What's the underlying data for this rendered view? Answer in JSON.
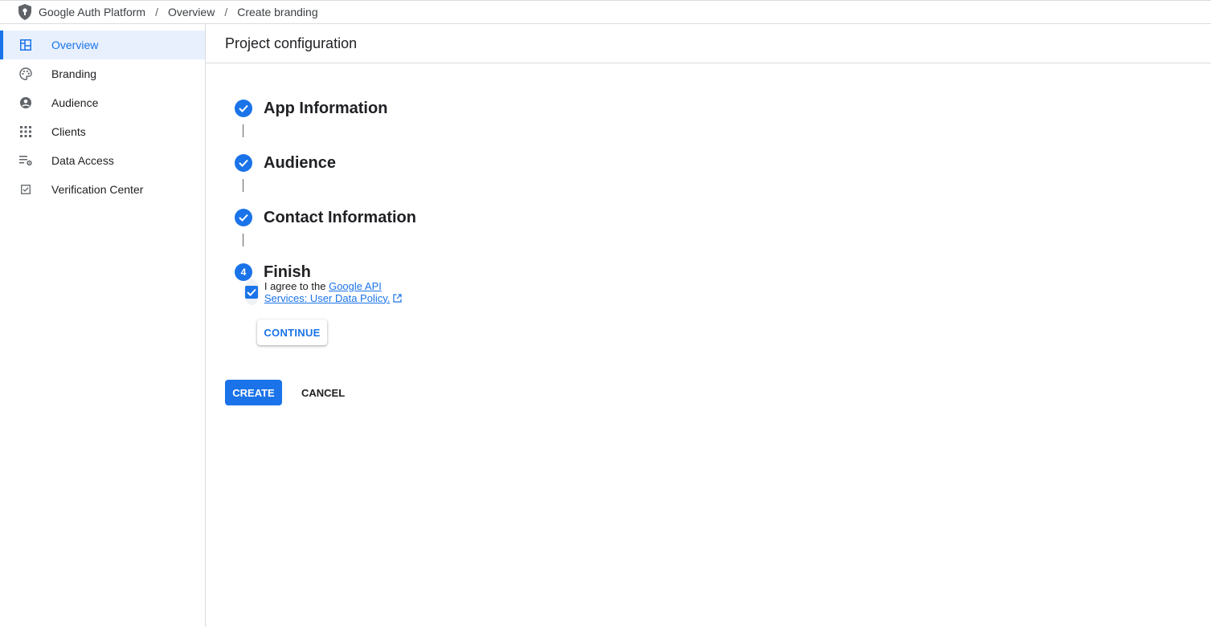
{
  "breadcrumb": {
    "items": [
      "Google Auth Platform",
      "Overview",
      "Create branding"
    ],
    "separator": "/"
  },
  "sidebar": {
    "items": [
      {
        "label": "Overview",
        "icon": "dashboard-icon",
        "active": true
      },
      {
        "label": "Branding",
        "icon": "palette-icon",
        "active": false
      },
      {
        "label": "Audience",
        "icon": "account-circle-icon",
        "active": false
      },
      {
        "label": "Clients",
        "icon": "apps-grid-icon",
        "active": false
      },
      {
        "label": "Data Access",
        "icon": "list-settings-icon",
        "active": false
      },
      {
        "label": "Verification Center",
        "icon": "checkbox-icon",
        "active": false
      }
    ]
  },
  "main": {
    "title": "Project configuration",
    "steps": [
      {
        "title": "App Information",
        "status": "complete"
      },
      {
        "title": "Audience",
        "status": "complete"
      },
      {
        "title": "Contact Information",
        "status": "complete"
      },
      {
        "title": "Finish",
        "status": "current",
        "number": "4"
      }
    ],
    "agreement": {
      "prefix": "I agree to the",
      "link_text": "Google API Services: User Data Policy.",
      "checked": true
    },
    "continue_label": "CONTINUE",
    "create_label": "CREATE",
    "cancel_label": "CANCEL"
  },
  "colors": {
    "accent": "#1a73e8",
    "active_bg": "#e8f0fe",
    "border": "#dadce0"
  }
}
